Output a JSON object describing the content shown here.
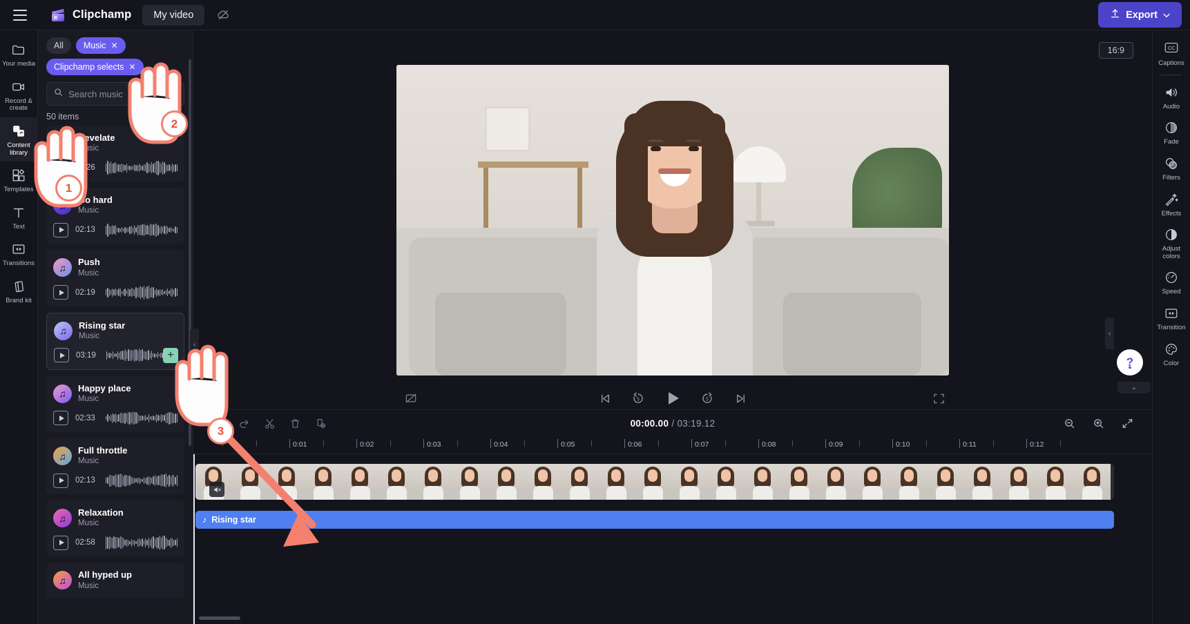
{
  "app": {
    "brand": "Clipchamp",
    "project_tab": "My video",
    "export_label": "Export",
    "menu_icon": "hamburger-icon",
    "cloud_icon": "cloud-offline-icon",
    "upload_icon": "upload-icon",
    "chevron_icon": "chevron-down-icon"
  },
  "left_rail": [
    {
      "label": "Your media",
      "icon": "folder-icon",
      "active": false
    },
    {
      "label": "Record & create",
      "icon": "video-camera-icon",
      "active": false
    },
    {
      "label": "Content library",
      "icon": "content-library-icon",
      "active": true
    },
    {
      "label": "Templates",
      "icon": "templates-icon",
      "active": false
    },
    {
      "label": "Text",
      "icon": "text-icon",
      "active": false
    },
    {
      "label": "Transitions",
      "icon": "transitions-icon",
      "active": false
    },
    {
      "label": "Brand kit",
      "icon": "brand-kit-icon",
      "active": false
    }
  ],
  "panel": {
    "chips": [
      {
        "label": "All",
        "active": false,
        "closable": false
      },
      {
        "label": "Music",
        "active": true,
        "closable": true
      },
      {
        "label": "Clipchamp selects",
        "active": true,
        "closable": true
      }
    ],
    "search": {
      "placeholder": "Search music",
      "value": "",
      "icon": "search-icon"
    },
    "count": "50 items",
    "tracks": [
      {
        "title": "Revelate",
        "subtitle": "Music",
        "duration": "02:26",
        "art": "music-note-icon",
        "c1": "#f0a8c8",
        "c2": "#b07de0",
        "selected": false,
        "add": false
      },
      {
        "title": "Go hard",
        "subtitle": "Music",
        "duration": "02:13",
        "art": "music-note-icon",
        "c1": "#7b4df0",
        "c2": "#4a2fc0",
        "selected": false,
        "add": false
      },
      {
        "title": "Push",
        "subtitle": "Music",
        "duration": "02:19",
        "art": "music-note-icon",
        "c1": "#f49ac0",
        "c2": "#6e8ef0",
        "selected": false,
        "add": false
      },
      {
        "title": "Rising star",
        "subtitle": "Music",
        "duration": "03:19",
        "art": "music-note-icon",
        "c1": "#b8c4f6",
        "c2": "#7f6ae8",
        "selected": true,
        "add": true
      },
      {
        "title": "Happy place",
        "subtitle": "Music",
        "duration": "02:33",
        "art": "music-note-icon",
        "c1": "#f09ad0",
        "c2": "#7a5cf0",
        "selected": false,
        "add": false
      },
      {
        "title": "Full throttle",
        "subtitle": "Music",
        "duration": "02:13",
        "art": "music-note-icon",
        "c1": "#f4a23c",
        "c2": "#5fa8e8",
        "selected": false,
        "add": false
      },
      {
        "title": "Relaxation",
        "subtitle": "Music",
        "duration": "02:58",
        "art": "music-note-icon",
        "c1": "#f06aa8",
        "c2": "#8a3ce0",
        "selected": false,
        "add": false
      },
      {
        "title": "All hyped up",
        "subtitle": "Music",
        "duration": "",
        "art": "music-note-icon",
        "c1": "#f4a03c",
        "c2": "#c04ce0",
        "selected": false,
        "add": false
      }
    ],
    "add_button_icon": "plus-icon",
    "collapse_icon": "chevron-left-icon"
  },
  "preview": {
    "aspect_ratio": "16:9",
    "controls": {
      "skip_start": "skip-to-start-icon",
      "back5": "rewind-5s-icon",
      "play": "play-icon",
      "forward5": "forward-5s-icon",
      "skip_end": "skip-to-end-icon",
      "fullscreen": "fullscreen-icon",
      "no_caption": "hide-captions-icon"
    }
  },
  "timeline": {
    "tools": [
      {
        "name": "undo",
        "icon": "undo-icon"
      },
      {
        "name": "redo",
        "icon": "redo-icon"
      },
      {
        "name": "split",
        "icon": "scissors-icon"
      },
      {
        "name": "delete",
        "icon": "trash-icon"
      },
      {
        "name": "duplicate",
        "icon": "duplicate-icon"
      }
    ],
    "current_time": "00:00.00",
    "separator": "/",
    "total_time": "03:19.12",
    "zoom_out_icon": "zoom-out-icon",
    "zoom_in_icon": "zoom-in-icon",
    "fit_icon": "fit-to-screen-icon",
    "ruler_labels": [
      "0:01",
      "0:02",
      "0:03",
      "0:04",
      "0:05",
      "0:06",
      "0:07",
      "0:08",
      "0:09",
      "0:10",
      "0:11",
      "0:12"
    ],
    "video_clip": {
      "name": "video-clip",
      "muted_icon": "mute-icon"
    },
    "audio_clip": {
      "label": "Rising star",
      "icon": "music-note-icon",
      "color": "#4f7ff0"
    }
  },
  "right_rail": [
    {
      "label": "Captions",
      "icon": "captions-icon"
    },
    {
      "label": "Audio",
      "icon": "audio-icon"
    },
    {
      "label": "Fade",
      "icon": "fade-icon"
    },
    {
      "label": "Filters",
      "icon": "filters-icon"
    },
    {
      "label": "Effects",
      "icon": "effects-icon"
    },
    {
      "label": "Adjust colors",
      "icon": "adjust-colors-icon"
    },
    {
      "label": "Speed",
      "icon": "speed-icon"
    },
    {
      "label": "Transition",
      "icon": "transition-icon"
    },
    {
      "label": "Color",
      "icon": "color-palette-icon"
    }
  ],
  "help": {
    "label": "?",
    "icon": "help-icon"
  },
  "annotations": {
    "steps": [
      {
        "number": "1"
      },
      {
        "number": "2"
      },
      {
        "number": "3"
      }
    ],
    "accent_color": "#f4806f"
  }
}
